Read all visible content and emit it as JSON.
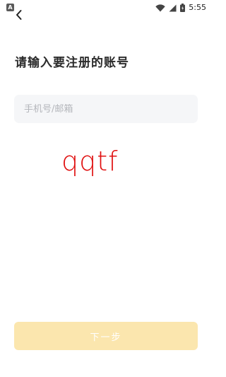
{
  "status_bar": {
    "notification_icon": "A",
    "time": "5:55",
    "icons": [
      "wifi-icon",
      "signal-icon",
      "battery-icon"
    ]
  },
  "header": {
    "back_icon": "chevron-left-icon"
  },
  "main": {
    "title": "请输入要注册的账号",
    "account_input": {
      "value": "",
      "placeholder": "手机号/邮箱"
    },
    "captcha_text": "qqtf",
    "next_button_label": "下一步"
  },
  "colors": {
    "title": "#2b2b2b",
    "input_bg": "#f5f6f8",
    "placeholder": "#b4b6bb",
    "captcha_text": "#e01010",
    "button_bg_disabled": "#fbe6ae",
    "button_text": "#ffffff"
  }
}
